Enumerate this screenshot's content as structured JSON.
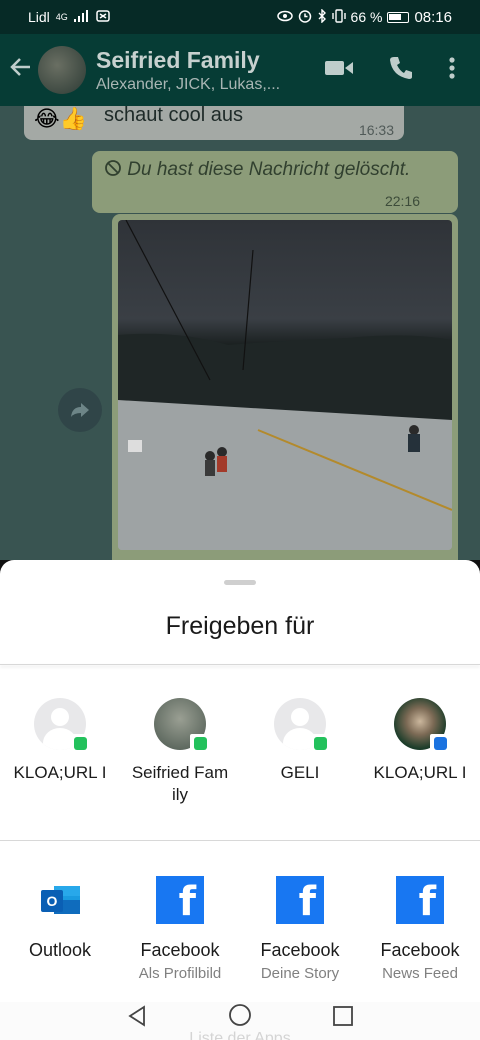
{
  "status_bar": {
    "carrier": "Lidl",
    "network": "4G",
    "battery_pct": "66 %",
    "time": "08:16"
  },
  "chat_header": {
    "title": "Seifried Family",
    "subtitle": "Alexander, JICK, Lukas,..."
  },
  "messages": {
    "incoming_text": "schaut cool aus",
    "incoming_emoji": "😂👍",
    "incoming_time": "16:33",
    "deleted_text": "Du hast diese Nachricht gelöscht.",
    "deleted_time": "22:16"
  },
  "share_sheet": {
    "title": "Freigeben für",
    "contacts": [
      {
        "name": "KLOA;URL I",
        "badge": "whatsapp"
      },
      {
        "name": "Seifried Family",
        "badge": "whatsapp"
      },
      {
        "name": "GELI",
        "badge": "whatsapp"
      },
      {
        "name": "KLOA;URL I",
        "badge": "messages"
      }
    ],
    "apps": [
      {
        "name": "Outlook",
        "sub": ""
      },
      {
        "name": "Facebook",
        "sub": "Als Profilbild"
      },
      {
        "name": "Facebook",
        "sub": "Deine Story"
      },
      {
        "name": "Facebook",
        "sub": "News Feed"
      }
    ]
  },
  "nav": {
    "ghost_label": "Liste der Apps"
  },
  "colors": {
    "whatsapp_badge": "#23c15c",
    "messages_badge": "#1b73e0",
    "facebook": "#1877f2"
  }
}
